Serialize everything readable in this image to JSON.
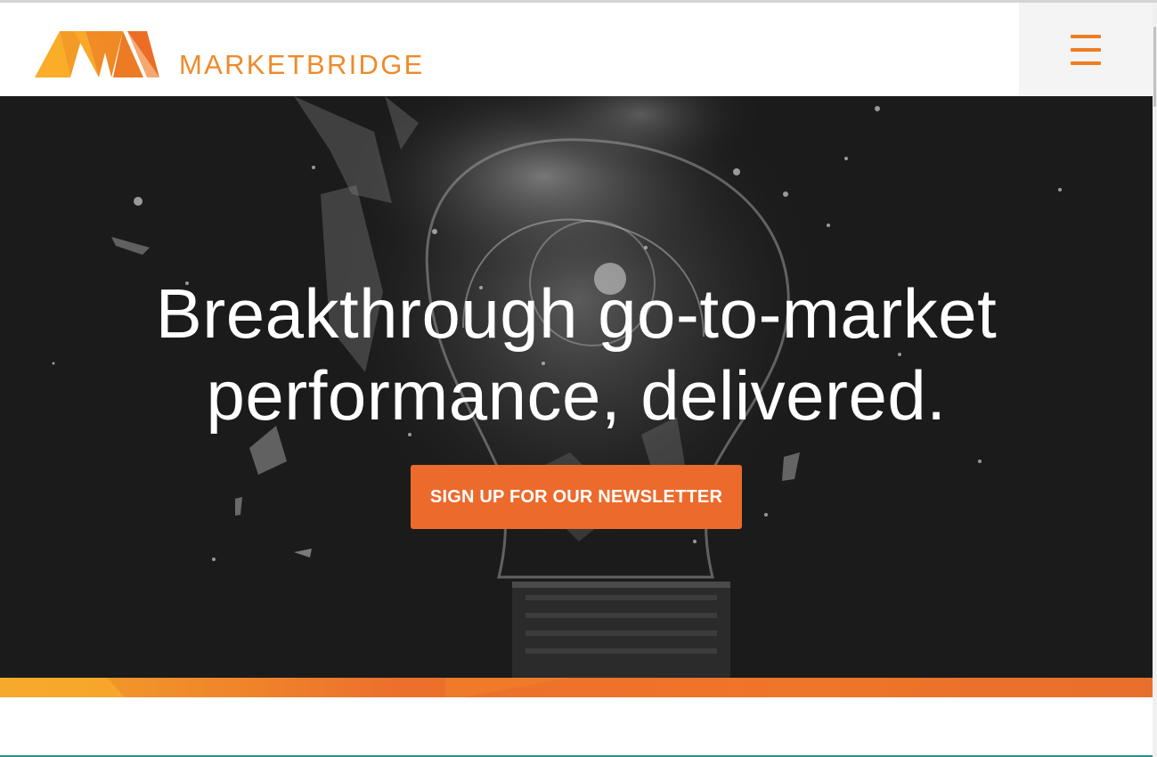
{
  "header": {
    "logo_text": "MARKETBRIDGE",
    "menu_icon": "hamburger-menu-icon"
  },
  "hero": {
    "title_line1": "Breakthrough go-to-market",
    "title_line2": "performance, delivered.",
    "cta_label": "SIGN UP FOR OUR NEWSLETTER",
    "background_image": "shattered-lightbulb-image"
  },
  "colors": {
    "brand_orange": "#ef8a2a",
    "cta_orange": "#ec6a2c",
    "hero_background": "#1b1b1b",
    "menu_background": "#f4f4f4"
  }
}
